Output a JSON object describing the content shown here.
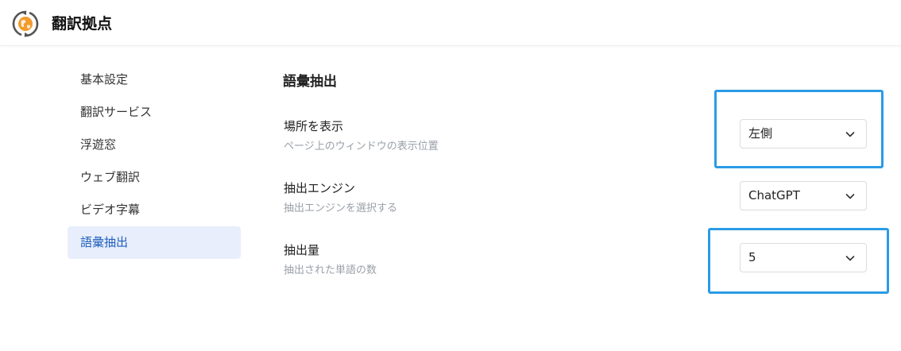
{
  "header": {
    "title": "翻訳拠点",
    "logo_icon": "globe-sync-icon"
  },
  "sidebar": {
    "items": [
      {
        "label": "基本設定",
        "active": false
      },
      {
        "label": "翻訳サービス",
        "active": false
      },
      {
        "label": "浮遊窓",
        "active": false
      },
      {
        "label": "ウェブ翻訳",
        "active": false
      },
      {
        "label": "ビデオ字幕",
        "active": false
      },
      {
        "label": "語彙抽出",
        "active": true
      }
    ]
  },
  "main": {
    "section_title": "語彙抽出",
    "rows": [
      {
        "label": "場所を表示",
        "description": "ページ上のウィンドウの表示位置",
        "value": "左側"
      },
      {
        "label": "抽出エンジン",
        "description": "抽出エンジンを選択する",
        "value": "ChatGPT"
      },
      {
        "label": "抽出量",
        "description": "抽出された単語の数",
        "value": "5"
      }
    ]
  },
  "colors": {
    "accent": "#1f5fbf",
    "active_bg": "#e8eefb",
    "highlight": "#2b9be6",
    "muted": "#9aa0a8"
  }
}
